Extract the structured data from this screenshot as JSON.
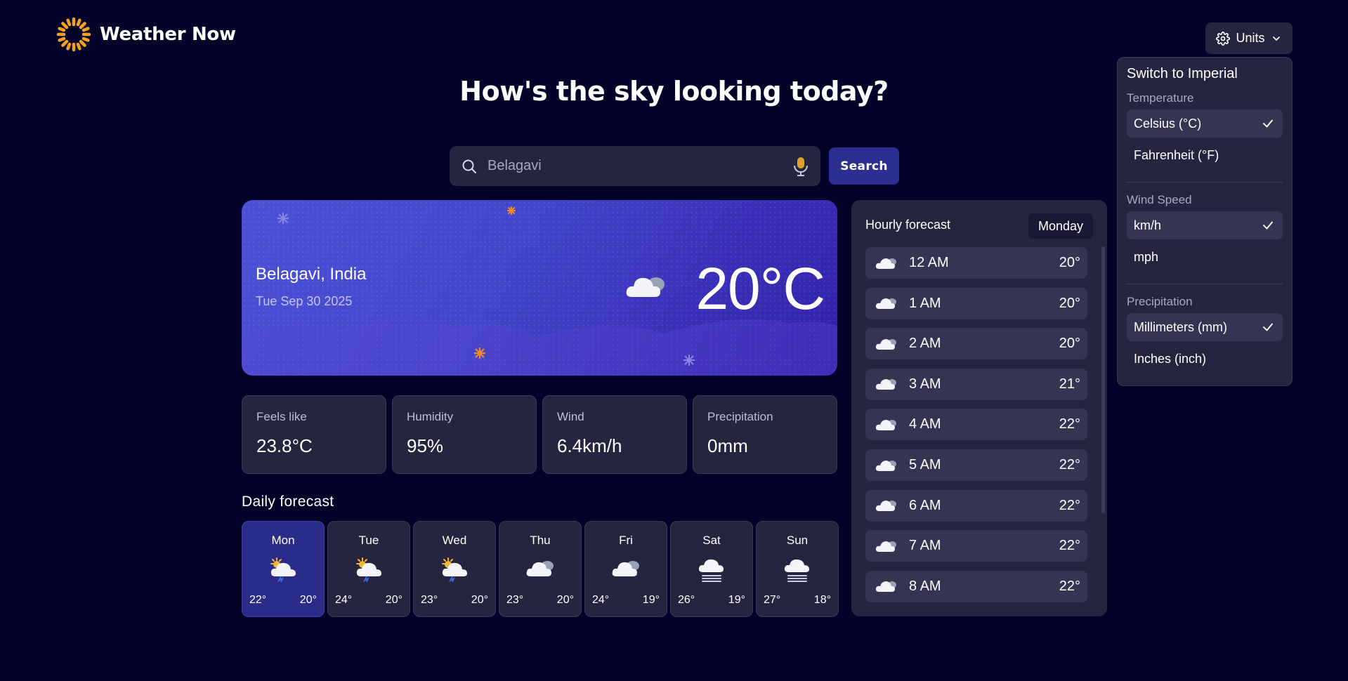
{
  "app": {
    "name": "Weather Now"
  },
  "units_button": {
    "label": "Units"
  },
  "hero": {
    "title": "How's the sky looking today?"
  },
  "search": {
    "value": "Belagavi",
    "button_label": "Search"
  },
  "current": {
    "location": "Belagavi, India",
    "date": "Tue Sep 30 2025",
    "temperature": "20°C",
    "icon": "partly-cloudy-icon"
  },
  "stats": [
    {
      "label": "Feels like",
      "value": "23.8°C"
    },
    {
      "label": "Humidity",
      "value": "95%"
    },
    {
      "label": "Wind",
      "value": "6.4km/h"
    },
    {
      "label": "Precipitation",
      "value": "0mm"
    }
  ],
  "daily": {
    "title": "Daily forecast",
    "days": [
      {
        "day": "Mon",
        "hi": "22°",
        "lo": "20°",
        "icon": "storm-icon"
      },
      {
        "day": "Tue",
        "hi": "24°",
        "lo": "20°",
        "icon": "storm-icon"
      },
      {
        "day": "Wed",
        "hi": "23°",
        "lo": "20°",
        "icon": "storm-icon"
      },
      {
        "day": "Thu",
        "hi": "23°",
        "lo": "20°",
        "icon": "partly-cloudy-icon"
      },
      {
        "day": "Fri",
        "hi": "24°",
        "lo": "19°",
        "icon": "partly-cloudy-icon"
      },
      {
        "day": "Sat",
        "hi": "26°",
        "lo": "19°",
        "icon": "fog-icon"
      },
      {
        "day": "Sun",
        "hi": "27°",
        "lo": "18°",
        "icon": "fog-icon"
      }
    ]
  },
  "hourly": {
    "title": "Hourly forecast",
    "selected_day": "Monday",
    "hours": [
      {
        "time": "12 AM",
        "temp": "20°"
      },
      {
        "time": "1 AM",
        "temp": "20°"
      },
      {
        "time": "2 AM",
        "temp": "20°"
      },
      {
        "time": "3 AM",
        "temp": "21°"
      },
      {
        "time": "4 AM",
        "temp": "22°"
      },
      {
        "time": "5 AM",
        "temp": "22°"
      },
      {
        "time": "6 AM",
        "temp": "22°"
      },
      {
        "time": "7 AM",
        "temp": "22°"
      },
      {
        "time": "8 AM",
        "temp": "22°"
      }
    ]
  },
  "units_menu": {
    "switch_label": "Switch to Imperial",
    "sections": {
      "temperature": {
        "title": "Temperature",
        "options": [
          "Celsius (°C)",
          "Fahrenheit (°F)"
        ],
        "selected": 0
      },
      "wind": {
        "title": "Wind Speed",
        "options": [
          "km/h",
          "mph"
        ],
        "selected": 0
      },
      "precip": {
        "title": "Precipitation",
        "options": [
          "Millimeters (mm)",
          "Inches (inch)"
        ],
        "selected": 0
      }
    }
  },
  "colors": {
    "background": "#03032a",
    "card": "#262540",
    "accent": "#2c2f8f",
    "sun": "#f5a023"
  }
}
